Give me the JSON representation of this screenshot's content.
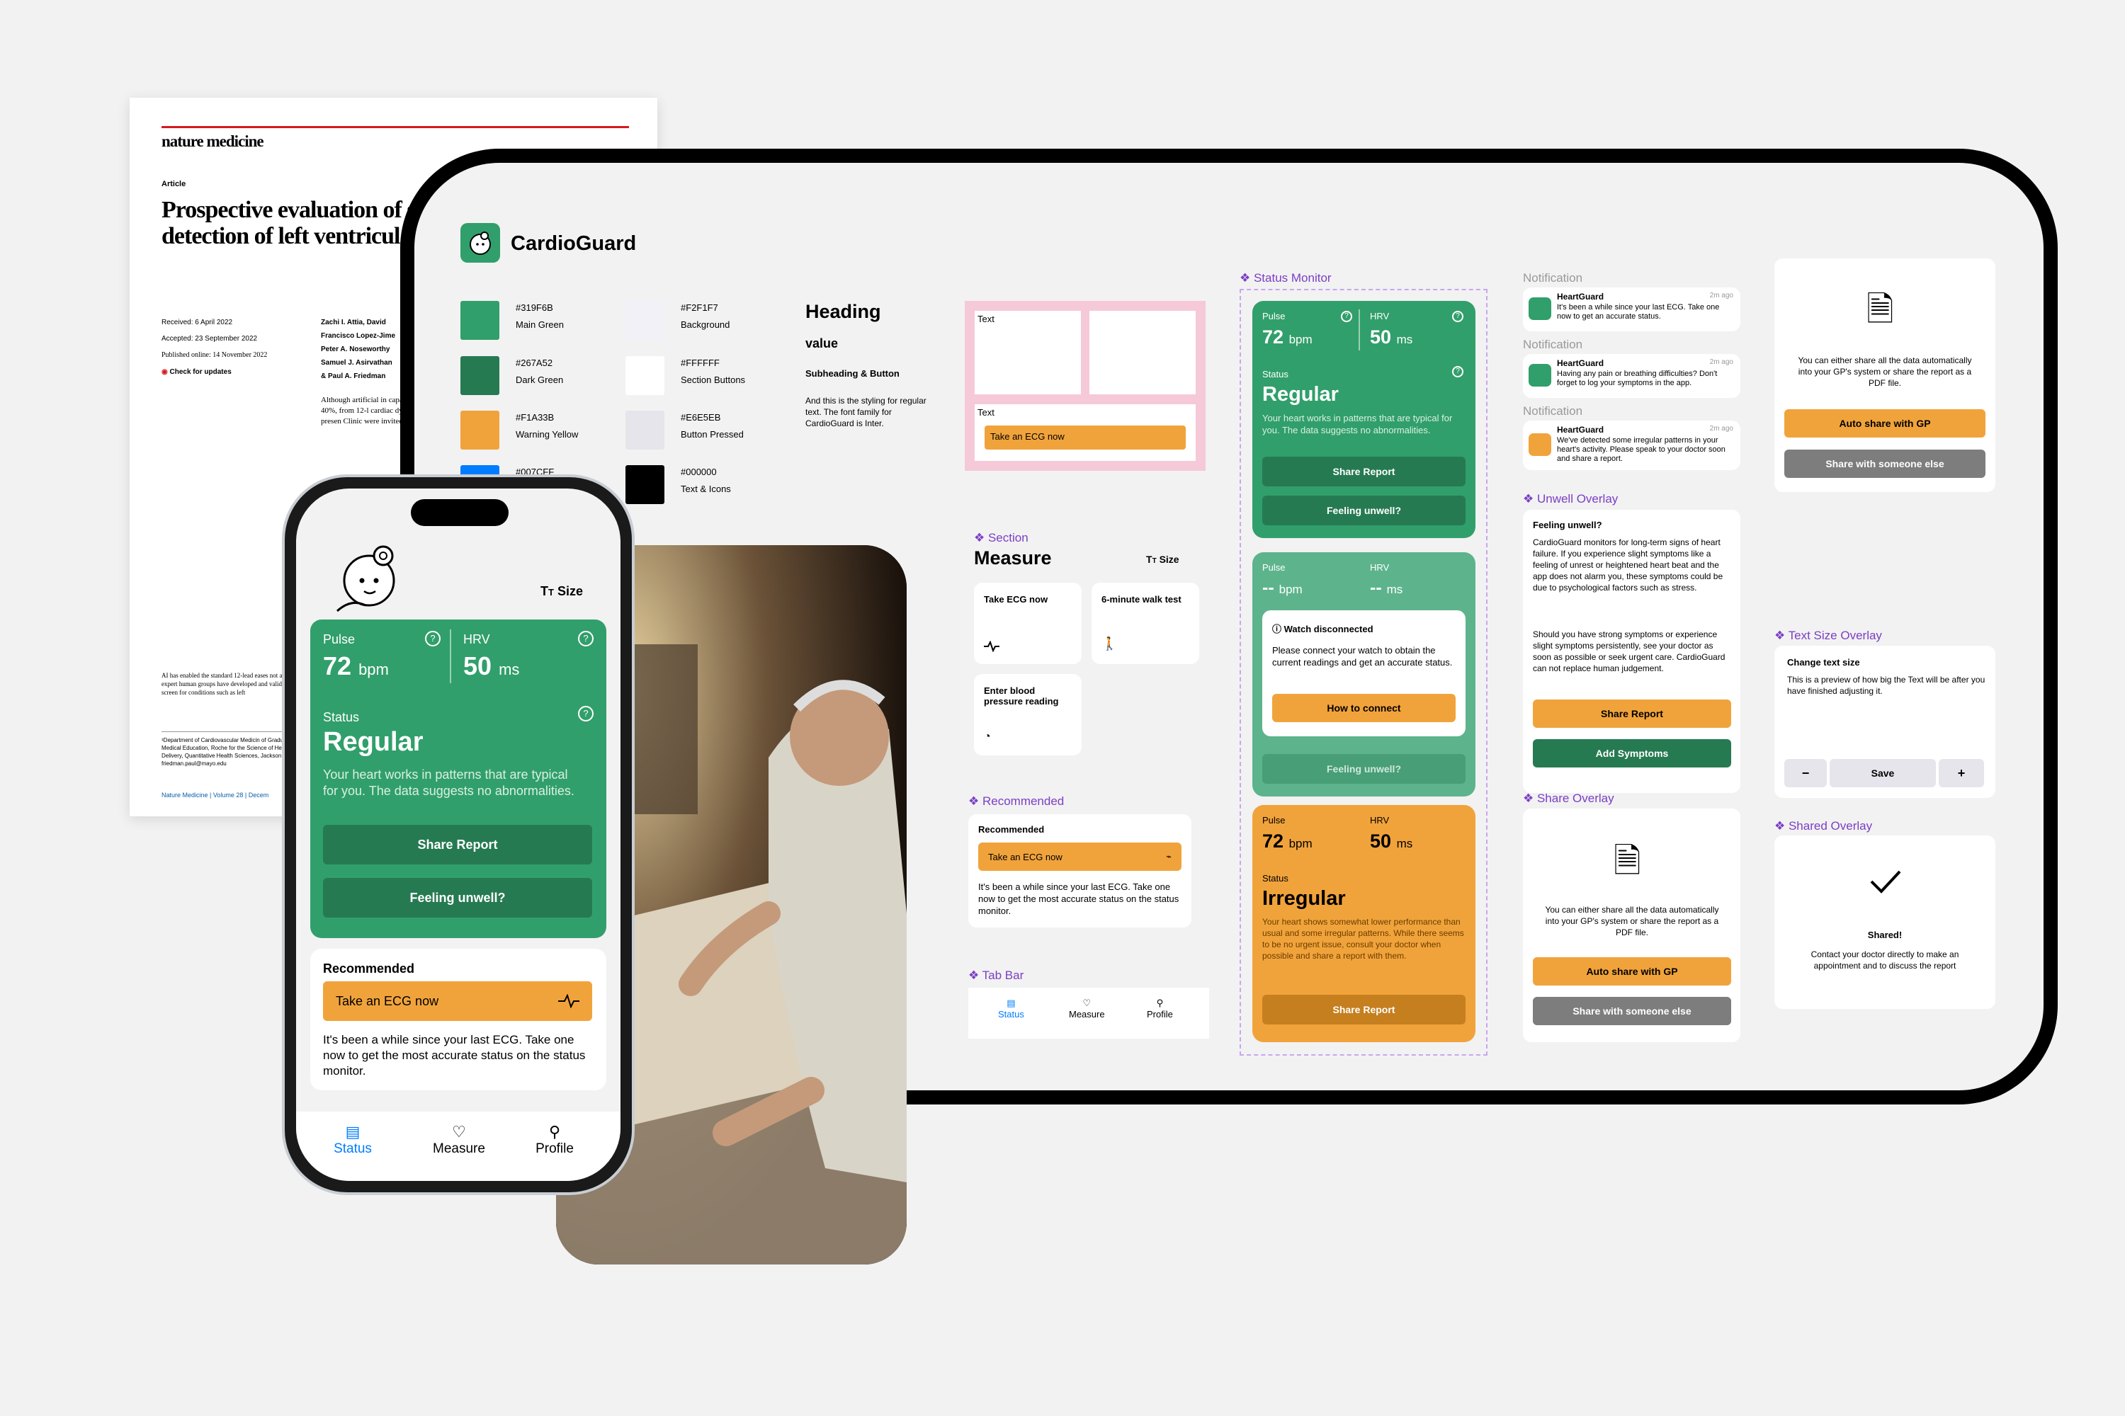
{
  "paper": {
    "journal": "nature medicine",
    "kind": "Article",
    "title": "Prospective evaluation of smartwatch-enabled detection of left ventricular dysfunction",
    "received": "Received: 6 April 2022",
    "accepted": "Accepted: 23 September 2022",
    "published": "Published online: 14 November 2022",
    "updates": "Check for updates",
    "authors": [
      "Zachi I. Attia, David",
      "Francisco Lopez-Jime",
      "Peter A. Noseworthy",
      "Samuel J. Asirvathan",
      "& Paul A. Friedman"
    ],
    "body": "Although artificial in capable of identifyin (EF) ≤ 40%, from 12-l cardiac dysfunction tested. In the presen Clinic were invited b",
    "abstract": "AI has enabled the standard 12-lead eases not apparent to expert human groups have developed and validat to screen for conditions such as left",
    "footnote": "¹Department of Cardiovascular Medicin of Graduate Medical Education, Roche for the Science of Health Care Delivery, Quantitative Health Sciences, Jackson, e-mail: friedman.paul@mayo.edu",
    "footer": "Nature Medicine | Volume 28 | Decem"
  },
  "app": {
    "name": "CardioGuard"
  },
  "colors": [
    {
      "hex": "#319F6B",
      "name": "Main Green"
    },
    {
      "hex": "#267A52",
      "name": "Dark Green"
    },
    {
      "hex": "#F1A33B",
      "name": "Warning Yellow"
    },
    {
      "hex": "#007CFF",
      "name": ""
    },
    {
      "hex": "#F2F1F7",
      "name": "Background"
    },
    {
      "hex": "#FFFFFF",
      "name": "Section Buttons"
    },
    {
      "hex": "#E6E5EB",
      "name": "Button Pressed"
    },
    {
      "hex": "#000000",
      "name": "Text & Icons"
    }
  ],
  "typo": {
    "heading": "Heading",
    "value": "value",
    "sub": "Subheading & Button",
    "regular": "And this is the styling for regular text. The font family for CardioGuard is Inter."
  },
  "spacing": {
    "text1": "Text",
    "text2": "Text",
    "btn": "Take an ECG now"
  },
  "section": {
    "label": "Section",
    "title": "Measure",
    "size": "Size",
    "items": [
      "Take ECG now",
      "6-minute walk test",
      "Enter blood pressure reading"
    ]
  },
  "recommended": {
    "label": "Recommended",
    "title": "Recommended",
    "btn": "Take an ECG now",
    "text": "It's been a while since your  last ECG. Take one now to  get the most accurate status on the status monitor."
  },
  "tabbar": {
    "label": "Tab Bar",
    "tabs": [
      "Status",
      "Measure",
      "Profile"
    ]
  },
  "status": {
    "label": "Status Monitor",
    "pulse": "Pulse",
    "hrv": "HRV",
    "bpm": "bpm",
    "ms": "ms",
    "pulse_val": "72",
    "hrv_val": "50",
    "dash": "--",
    "status": "Status",
    "regular": "Regular",
    "regular_text": "Your heart works in patterns that are typical for you. The data suggests no abnormalities.",
    "share": "Share Report",
    "unwell": "Feeling unwell?",
    "disc_title": "Watch disconnected",
    "disc_text": "Please connect your watch to obtain the current readings and get an accurate status.",
    "connect": "How to connect",
    "irregular": "Irregular",
    "irregular_text": "Your heart shows somewhat lower performance than usual and some irregular patterns. While there seems to be no urgent issue, consult your doctor when possible and share a report with them."
  },
  "notifications": {
    "label": "Notification",
    "app": "HeartGuard",
    "time": "2m ago",
    "items": [
      "It's been a while since your last ECG. Take one now to get an accurate status.",
      "Having any pain or breathing difficulties? Don't forget to log your symptoms in the app.",
      "We've detected some irregular patterns in your heart's activity. Please speak to your doctor soon and share a report."
    ]
  },
  "unwell": {
    "label": "Unwell Overlay",
    "title": "Feeling unwell?",
    "p1": "CardioGuard monitors for long-term signs of heart failure. If you experience slight symptoms like a feeling of unrest or heightened heart beat and the app does not alarm you, these symptoms could be due to psychological factors such as stress.",
    "p2": "Should you have strong symptoms or experience slight symptoms persistently, see your doctor as soon as possible or seek urgent care. CardioGuard can not replace human judgement.",
    "share": "Share Report",
    "add": "Add Symptoms"
  },
  "share": {
    "label": "Share Overlay",
    "text": "You can either share all the data automatically into your GP's system or share the report as a PDF file.",
    "auto": "Auto share with GP",
    "else": "Share with someone else"
  },
  "textsize": {
    "label": "Text Size Overlay",
    "title": "Change text size",
    "text": "This is a preview of how big the Text will be after you have finished adjusting it.",
    "minus": "−",
    "save": "Save",
    "plus": "+"
  },
  "shared": {
    "label": "Shared Overlay",
    "title": "Shared!",
    "text": "Contact your doctor directly to make an appointment and to discuss the report"
  },
  "phone": {
    "size": "Size"
  }
}
